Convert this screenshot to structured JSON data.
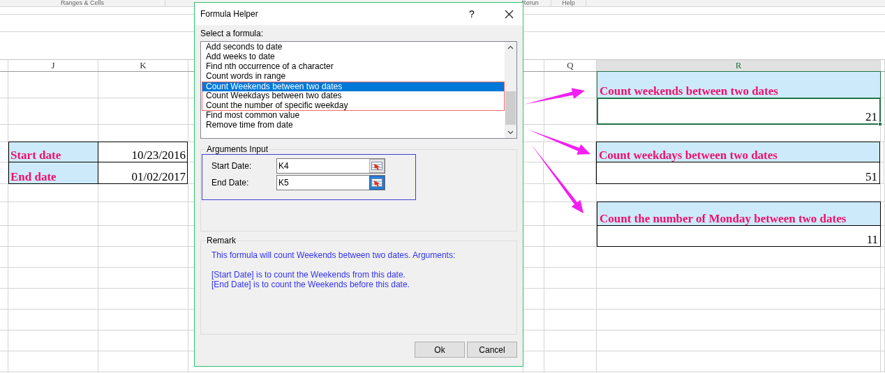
{
  "ribbon_groups": [
    "Ranges & Cells",
    "Rerun",
    "Help"
  ],
  "column_headers": [
    {
      "label": "J",
      "selected": false
    },
    {
      "label": "K",
      "selected": false
    },
    {
      "label": "Q",
      "selected": false
    },
    {
      "label": "R",
      "selected": true
    }
  ],
  "dates_table": [
    {
      "label": "Start date",
      "value": "10/23/2016"
    },
    {
      "label": "End date",
      "value": "01/02/2017"
    }
  ],
  "results": [
    {
      "title": "Count weekends between two dates",
      "value": "21",
      "selected": true
    },
    {
      "title": "Count weekdays between two dates",
      "value": "51",
      "selected": false
    },
    {
      "title": "Count the number of Monday between two dates",
      "value": "11",
      "selected": false
    }
  ],
  "dialog": {
    "title": "Formula Helper",
    "help": "?",
    "list_label": "Select a formula:",
    "formulas": [
      {
        "label": "Add seconds to date",
        "selected": false,
        "framed": false
      },
      {
        "label": "Add weeks to date",
        "selected": false,
        "framed": false
      },
      {
        "label": "Find nth occurrence of a character",
        "selected": false,
        "framed": false
      },
      {
        "label": "Count words in range",
        "selected": false,
        "framed": false
      },
      {
        "label": "Count Weekends between two dates",
        "selected": true,
        "framed": true
      },
      {
        "label": "Count Weekdays between two dates",
        "selected": false,
        "framed": true
      },
      {
        "label": "Count the number of specific weekday",
        "selected": false,
        "framed": true
      },
      {
        "label": "Find most common value",
        "selected": false,
        "framed": false
      },
      {
        "label": "Remove time from date",
        "selected": false,
        "framed": false
      }
    ],
    "arguments": {
      "legend": "Arguments Input",
      "fields": [
        {
          "label": "Start Date:",
          "value": "K4",
          "focused": false
        },
        {
          "label": "End Date:",
          "value": "K5",
          "focused": true
        }
      ]
    },
    "remark": {
      "legend": "Remark",
      "paragraphs": [
        [
          "This formula will count Weekends between two dates. Arguments:"
        ],
        [
          "[Start Date] is to count the Weekends from this date.",
          "[End Date] is to count the Weekends before this date."
        ]
      ]
    },
    "buttons": [
      "Ok",
      "Cancel"
    ]
  }
}
